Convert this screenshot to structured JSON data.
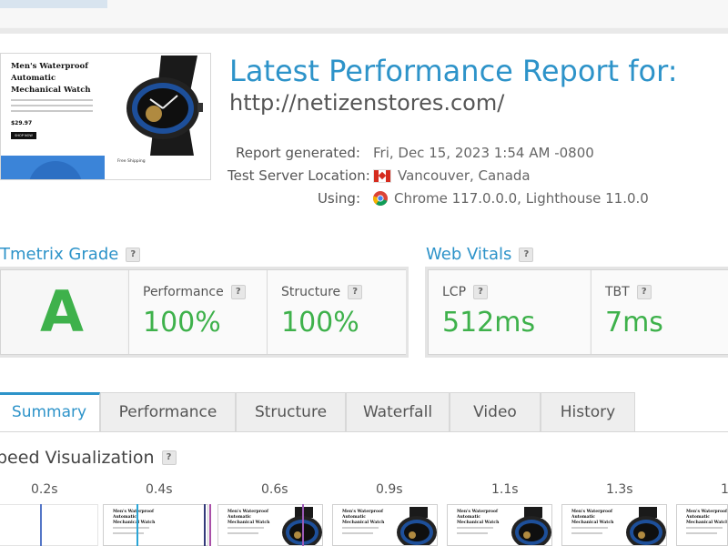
{
  "thumbnail": {
    "title": "Men's Waterproof Automatic Mechanical Watch",
    "price": "$29.97",
    "button": "SHOP NOW",
    "sub_caption": "Free Shipping"
  },
  "report": {
    "title": "Latest Performance Report for:",
    "url": "http://netizenstores.com/",
    "generated_label": "Report generated:",
    "generated_value": "Fri, Dec 15, 2023 1:54 AM -0800",
    "location_label": "Test Server Location:",
    "location_value": "Vancouver, Canada",
    "using_label": "Using:",
    "using_value": "Chrome 117.0.0.0, Lighthouse 11.0.0"
  },
  "grade": {
    "title": "Tmetrix Grade",
    "letter": "A",
    "performance_label": "Performance",
    "performance_value": "100%",
    "structure_label": "Structure",
    "structure_value": "100%"
  },
  "vitals": {
    "title": "Web Vitals",
    "lcp_label": "LCP",
    "lcp_value": "512ms",
    "tbt_label": "TBT",
    "tbt_value": "7ms"
  },
  "help_glyph": "?",
  "tabs": [
    {
      "label": "Summary",
      "active": true
    },
    {
      "label": "Performance",
      "active": false
    },
    {
      "label": "Structure",
      "active": false
    },
    {
      "label": "Waterfall",
      "active": false
    },
    {
      "label": "Video",
      "active": false
    },
    {
      "label": "History",
      "active": false
    }
  ],
  "speed": {
    "title": "peed Visualization",
    "ticks": [
      "0.2s",
      "0.4s",
      "0.6s",
      "0.9s",
      "1.1s",
      "1.3s",
      "1"
    ],
    "frame_title": "Men's Waterproof Automatic Mechanical Watch"
  },
  "colors": {
    "accent": "#2d93c9",
    "grade_green": "#3eb14b"
  },
  "icons": {
    "flag": "canada-flag-icon",
    "browser": "chrome-icon",
    "help": "help-icon"
  }
}
